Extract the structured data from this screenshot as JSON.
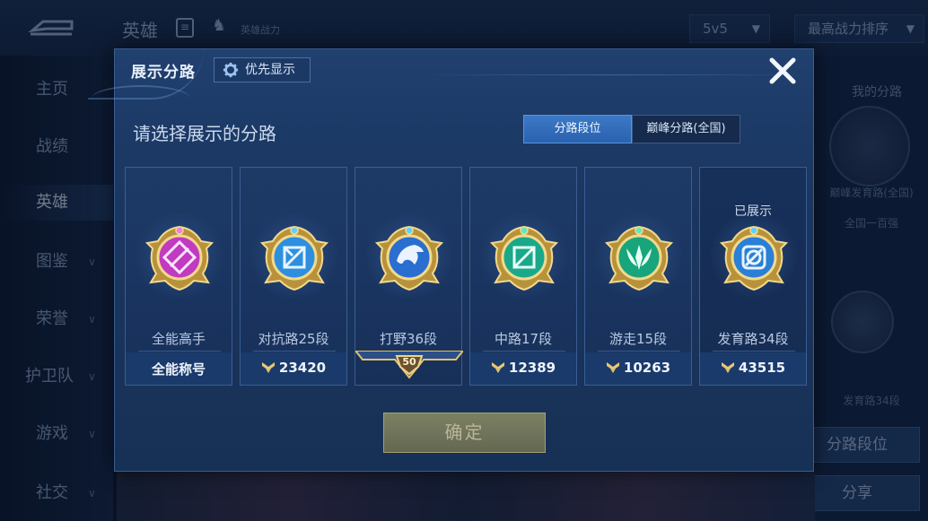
{
  "background": {
    "header": {
      "title": "英雄",
      "subtitle": "英雄战力",
      "mode_select": "5v5",
      "sort_select": "最高战力排序"
    },
    "nav": [
      {
        "label": "主页",
        "has_chevron": false
      },
      {
        "label": "战绩",
        "has_chevron": false
      },
      {
        "label": "英雄",
        "has_chevron": false
      },
      {
        "label": "图鉴",
        "has_chevron": true
      },
      {
        "label": "荣誉",
        "has_chevron": true
      },
      {
        "label": "护卫队",
        "has_chevron": true
      },
      {
        "label": "游戏",
        "has_chevron": true
      },
      {
        "label": "社交",
        "has_chevron": true
      }
    ],
    "right_panel": {
      "title": "我的分路",
      "emblem_label": "巅峰发育路(全国)",
      "rank_text": "全国一百强",
      "emblem2_label": "发育路34段",
      "button_lane": "分路段位",
      "button_share": "分享"
    }
  },
  "dialog": {
    "title": "展示分路",
    "priority_button": "优先显示",
    "subtitle": "请选择展示的分路",
    "tabs": [
      {
        "label": "分路段位",
        "active": true
      },
      {
        "label": "巅峰分路(全国)",
        "active": false
      }
    ],
    "cards": [
      {
        "name": "全能高手",
        "score": "全能称号",
        "status": "",
        "emblem": "all-round-emblem-icon",
        "color": "#c03bc0",
        "star": ""
      },
      {
        "name": "对抗路25段",
        "score": "23420",
        "status": "",
        "emblem": "clash-lane-emblem-icon",
        "color": "#2d8fe0",
        "star": ""
      },
      {
        "name": "打野36段",
        "score": "",
        "status": "",
        "emblem": "jungle-emblem-icon",
        "color": "#2a6fd0",
        "star": "50"
      },
      {
        "name": "中路17段",
        "score": "12389",
        "status": "",
        "emblem": "mid-lane-emblem-icon",
        "color": "#1aa88a",
        "star": ""
      },
      {
        "name": "游走15段",
        "score": "10263",
        "status": "",
        "emblem": "roam-emblem-icon",
        "color": "#17a57c",
        "star": ""
      },
      {
        "name": "发育路34段",
        "score": "43515",
        "status": "已展示",
        "emblem": "farm-lane-emblem-icon",
        "color": "#2a7fd6",
        "star": ""
      }
    ],
    "confirm_button": "确定",
    "close_icon": "close-icon"
  }
}
